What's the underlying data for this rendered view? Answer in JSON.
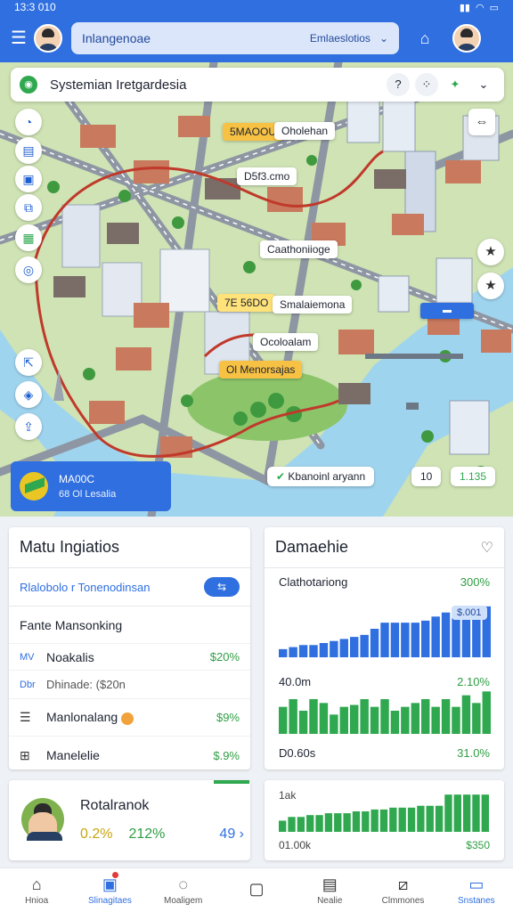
{
  "status": {
    "time": "13:3 010"
  },
  "appbar": {
    "search_label": "Inlangenoae",
    "chip_label": "Emlaeslotios"
  },
  "map": {
    "title": "Systemian Iretgardesia",
    "pills": [
      {
        "text": "5MAOOU"
      },
      {
        "text": "Oholehan"
      },
      {
        "text": "D5f3.cmo"
      },
      {
        "text": "Caathoniioge"
      },
      {
        "text": "7E 56DO"
      },
      {
        "text": "Smalaiemona"
      },
      {
        "text": "Ocoloalam"
      },
      {
        "text": "Ol Menorsajas"
      }
    ],
    "info_card": {
      "line1": "MA00C",
      "line2": "68 Ol Lesalia"
    },
    "chips": [
      {
        "text": "Kbanoinl aryann"
      },
      {
        "text": "10"
      },
      {
        "text": "1.135"
      }
    ]
  },
  "left_panel": {
    "title": "Matu Ingiatios",
    "sub_label": "Rlalobolo r Tonenodinsan",
    "section": "Fante Mansonking",
    "rows": [
      {
        "icon": "MV",
        "name": "Noakalis",
        "value": "$20%"
      },
      {
        "icon": "Dbr",
        "name": "Dhinade: ($20n",
        "value": ""
      },
      {
        "icon": "list",
        "name": "Manlonalang",
        "value": "$9%"
      },
      {
        "icon": "grid",
        "name": "Manelelie",
        "value": "$.9%"
      }
    ]
  },
  "right_panel": {
    "title": "Damaehie",
    "line1": {
      "label": "Clathotariong",
      "value": "300%"
    },
    "tag": "$.001",
    "line2": {
      "label": "40.0m",
      "value": "2.10%"
    },
    "line3": {
      "label": "D0.60s",
      "value": "31.0%"
    }
  },
  "bottom_left": {
    "name": "Rotalranok",
    "v1": "0.2%",
    "v2": "212%",
    "v3": "49"
  },
  "bottom_right": {
    "label_top": "1ak",
    "label_left": "01.00k",
    "label_right": "$350"
  },
  "nav": [
    {
      "label": "Hnioa"
    },
    {
      "label": "Slinagitaes"
    },
    {
      "label": "Moaligem"
    },
    {
      "label": ""
    },
    {
      "label": "Nealie"
    },
    {
      "label": "Clmmones"
    },
    {
      "label": "Snstanes"
    }
  ],
  "chart_data": [
    {
      "type": "bar",
      "title": "",
      "series": [
        {
          "name": "",
          "values": [
            4,
            5,
            6,
            6,
            7,
            8,
            9,
            10,
            11,
            14,
            17,
            17,
            17,
            17,
            18,
            20,
            22,
            22,
            24,
            24,
            25
          ]
        }
      ],
      "color": "#2f6fe0",
      "ylim": [
        0,
        28
      ]
    },
    {
      "type": "bar",
      "title": "",
      "series": [
        {
          "name": "",
          "values": [
            14,
            18,
            12,
            18,
            16,
            10,
            14,
            15,
            18,
            14,
            18,
            12,
            14,
            16,
            18,
            14,
            18,
            14,
            20,
            16,
            22
          ]
        }
      ],
      "color": "#2fa84f",
      "ylim": [
        0,
        24
      ]
    },
    {
      "type": "bar",
      "title": "",
      "series": [
        {
          "name": "",
          "values": [
            6,
            8,
            8,
            9,
            9,
            10,
            10,
            10,
            11,
            11,
            12,
            12,
            13,
            13,
            13,
            14,
            14,
            14,
            20,
            20,
            20,
            20,
            20
          ]
        }
      ],
      "color": "#2fa84f",
      "ylim": [
        0,
        22
      ]
    }
  ]
}
